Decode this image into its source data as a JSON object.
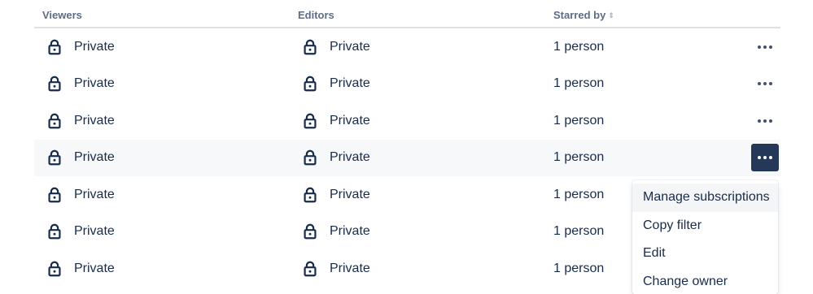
{
  "header": {
    "viewers": "Viewers",
    "editors": "Editors",
    "starred_by": "Starred by",
    "sort_icon": "sort-icon"
  },
  "rows": [
    {
      "viewers": "Private",
      "editors": "Private",
      "starred": "1 person"
    },
    {
      "viewers": "Private",
      "editors": "Private",
      "starred": "1 person"
    },
    {
      "viewers": "Private",
      "editors": "Private",
      "starred": "1 person"
    },
    {
      "viewers": "Private",
      "editors": "Private",
      "starred": "1 person",
      "active": true
    },
    {
      "viewers": "Private",
      "editors": "Private",
      "starred": "1 person"
    },
    {
      "viewers": "Private",
      "editors": "Private",
      "starred": "1 person"
    },
    {
      "viewers": "Private",
      "editors": "Private",
      "starred": "1 person"
    }
  ],
  "menu": {
    "items": [
      "Manage subscriptions",
      "Copy filter",
      "Edit",
      "Change owner"
    ]
  },
  "colors": {
    "text": "#172b4d",
    "header_text": "#5e6c84",
    "active_button": "#253858",
    "row_highlight": "#f7f8f9"
  }
}
